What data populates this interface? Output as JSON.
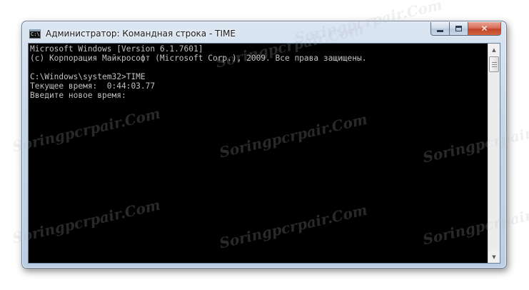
{
  "window": {
    "title": "Администратор: Командная строка - TIME",
    "icon": "cmd-icon",
    "icon_text": "C:\\"
  },
  "controls": {
    "minimize": "minimize-icon",
    "maximize": "maximize-icon",
    "close_label": "✕"
  },
  "console": {
    "lines": [
      "Microsoft Windows [Version 6.1.7601]",
      "(c) Корпорация Майкрософт (Microsoft Corp.), 2009. Все права защищены.",
      "",
      "C:\\Windows\\system32>TIME",
      "Текущее время:  0:44:03.77",
      "Введите новое время:"
    ]
  },
  "scrollbar": {
    "up": "▲",
    "down": "▼"
  },
  "watermark": {
    "text": "Soringpcrpair.Com"
  }
}
